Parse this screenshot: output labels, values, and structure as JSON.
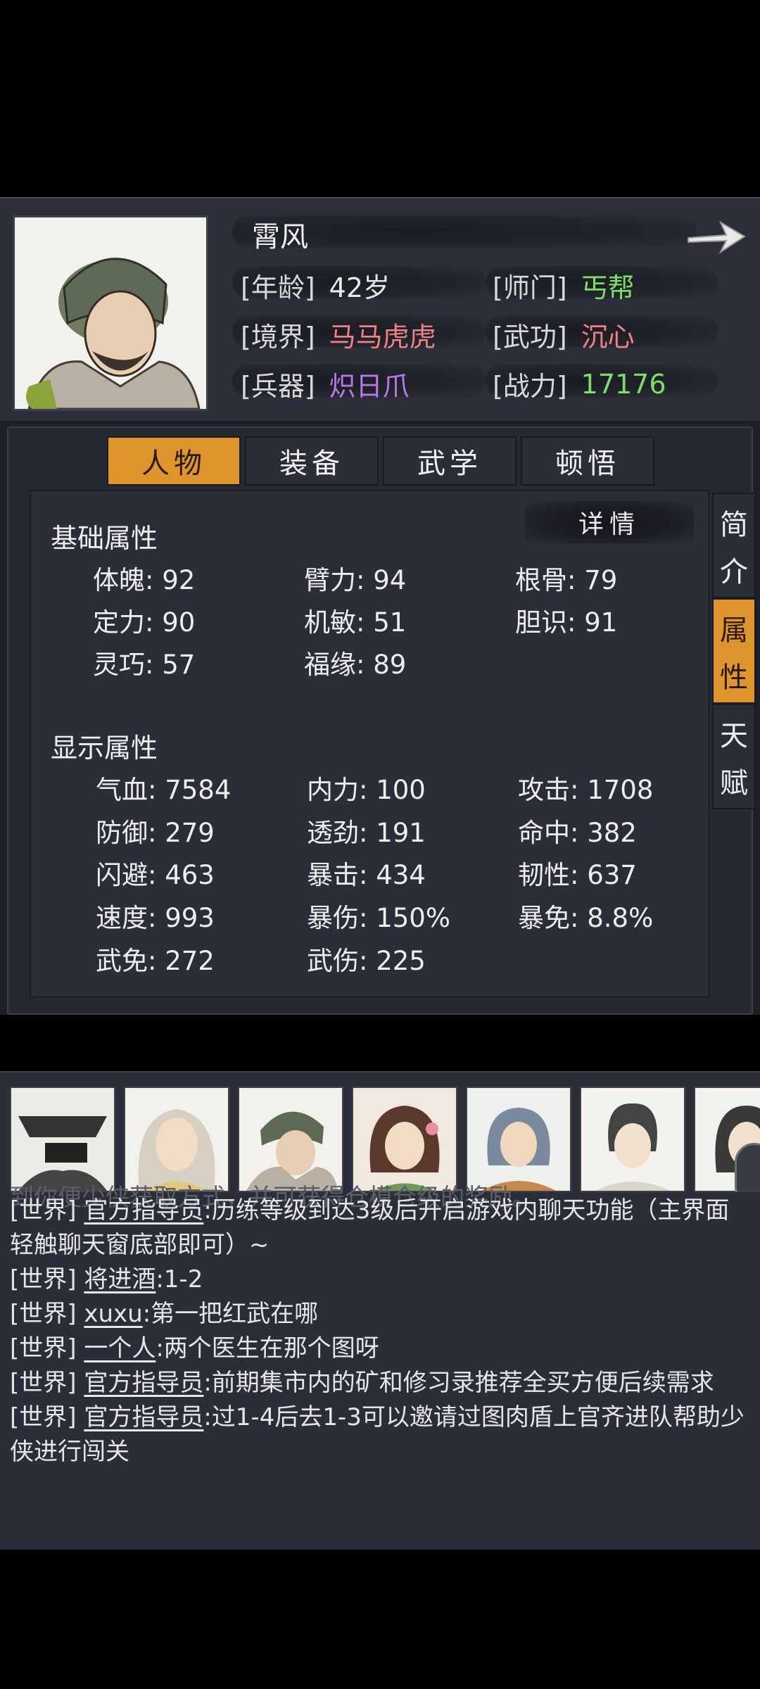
{
  "character": {
    "name": "霄风",
    "age_label": "[年龄]",
    "age": "42岁",
    "sect_label": "[师门]",
    "sect": "丐帮",
    "realm_label": "[境界]",
    "realm": "马马虎虎",
    "martial_label": "[武功]",
    "martial": "沉心",
    "weapon_label": "[兵器]",
    "weapon": "炽日爪",
    "power_label": "[战力]",
    "power": "17176"
  },
  "tabs": [
    "人物",
    "装备",
    "武学",
    "顿悟"
  ],
  "active_tab": "人物",
  "side_tabs": [
    {
      "chars": [
        "简",
        "介"
      ]
    },
    {
      "chars": [
        "属",
        "性"
      ]
    },
    {
      "chars": [
        "天",
        "赋"
      ]
    }
  ],
  "detail_button": "详情",
  "basic": {
    "title": "基础属性",
    "stats": [
      "体魄: 92",
      "臂力: 94",
      "根骨: 79",
      "定力: 90",
      "机敏: 51",
      "胆识: 91",
      "灵巧: 57",
      "福缘: 89"
    ]
  },
  "display": {
    "title": "显示属性",
    "stats": [
      "气血: 7584",
      "内力: 100",
      "攻击: 1708",
      "防御: 279",
      "透劲: 191",
      "命中: 382",
      "闪避: 463",
      "暴击: 434",
      "韧性: 637",
      "速度: 993",
      "暴伤: 150%",
      "暴免: 8.8%",
      "武免: 272",
      "武伤: 225"
    ]
  },
  "chat": {
    "faded_line": "到你便少侠获取方式，并可获得仓模仓级的奖励。",
    "messages": [
      {
        "channel": "[世界]",
        "user": "官方指导员",
        "text": ":历练等级到达3级后开启游戏内聊天功能（主界面轻触聊天窗底部即可）~"
      },
      {
        "channel": "[世界]",
        "user": "将进酒",
        "text": ":1-2"
      },
      {
        "channel": "[世界]",
        "user": "xuxu",
        "text": ":第一把红武在哪"
      },
      {
        "channel": "[世界]",
        "user": "一个人",
        "text": ":两个医生在那个图呀"
      },
      {
        "channel": "[世界]",
        "user": "官方指导员",
        "text": ":前期集市内的矿和修习录推荐全买方便后续需求"
      },
      {
        "channel": "[世界]",
        "user": "官方指导员",
        "text": ":过1-4后去1-3可以邀请过图肉盾上官齐进队帮助少侠进行闯关"
      }
    ]
  },
  "colors": {
    "accent_orange": "#e0942e",
    "green": "#7ddc6a",
    "pink": "#f07f86",
    "purple": "#b877ec"
  }
}
